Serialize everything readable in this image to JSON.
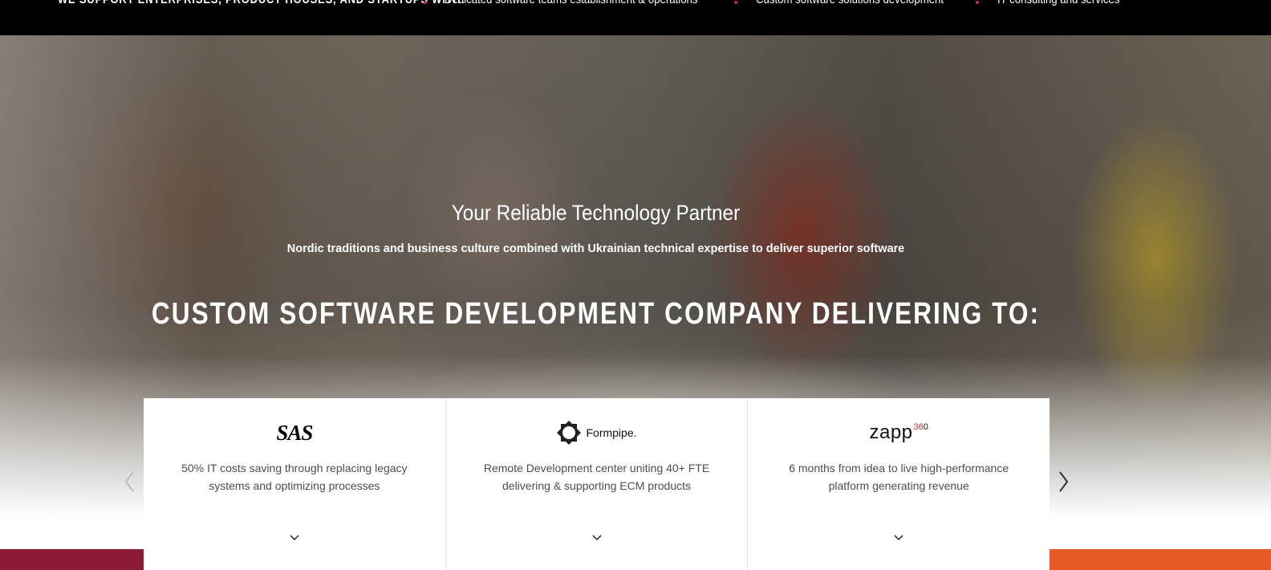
{
  "topbar": {
    "lead": "WE SUPPORT ENTERPRISES, PRODUCT HOUSES, AND STARTUPS WITH:",
    "services": [
      "Dedicated software teams establishment & operations",
      "Custom software solutions development",
      "IT consulting and services"
    ]
  },
  "hero": {
    "tagline": "Your Reliable Technology Partner",
    "subtitle": "Nordic traditions and business culture combined with Ukrainian technical expertise to deliver superior software",
    "headline": "CUSTOM SOFTWARE DEVELOPMENT COMPANY DELIVERING TO:"
  },
  "cases": [
    {
      "logo": "SAS",
      "description": "50% IT costs saving through replacing legacy systems and optimizing processes",
      "icon": "chevron-down-icon"
    },
    {
      "logo": "Formpipe.",
      "description": "Remote Development center uniting 40+ FTE delivering & supporting ECM products",
      "icon": "chevron-down-icon"
    },
    {
      "logo": "zapp",
      "logo_sup": "36",
      "logo_sup_accent": "0",
      "description": "6 months from idea to live high-performance platform generating revenue",
      "icon": "chevron-down-icon"
    }
  ],
  "carousel": {
    "prev_icon": "chevron-left-icon",
    "next_icon": "chevron-right-icon"
  },
  "colors": {
    "topbar_bg": "#000000",
    "accent_red": "#e1262d",
    "strip_left": "#8e1b35",
    "strip_right": "#e65a28"
  }
}
